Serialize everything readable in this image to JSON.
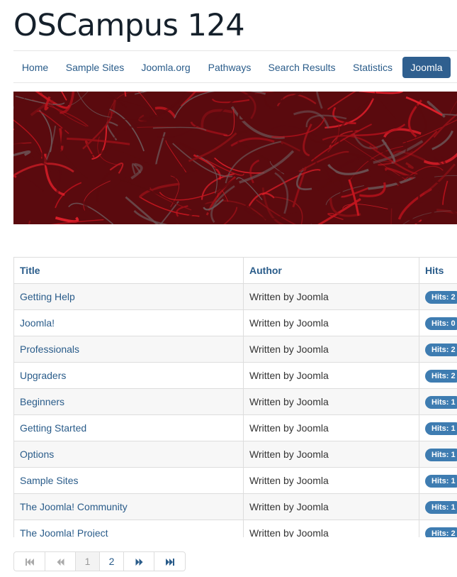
{
  "site": {
    "title": "OSCampus 124"
  },
  "nav": {
    "items": [
      {
        "label": "Home"
      },
      {
        "label": "Sample Sites"
      },
      {
        "label": "Joomla.org"
      },
      {
        "label": "Pathways"
      },
      {
        "label": "Search Results"
      },
      {
        "label": "Statistics"
      },
      {
        "label": "Joomla",
        "active": true
      }
    ]
  },
  "hero": {
    "image": "red-grass-banner",
    "colors": {
      "dark": "#5a0a0e",
      "mid": "#b3111b",
      "bright": "#e01f2a"
    }
  },
  "table": {
    "headers": {
      "title": "Title",
      "author": "Author",
      "hits": "Hits"
    },
    "rows": [
      {
        "title": "Getting Help",
        "author": "Written by Joomla",
        "hits": "Hits: 2"
      },
      {
        "title": "Joomla!",
        "author": "Written by Joomla",
        "hits": "Hits: 0"
      },
      {
        "title": "Professionals",
        "author": "Written by Joomla",
        "hits": "Hits: 2"
      },
      {
        "title": "Upgraders",
        "author": "Written by Joomla",
        "hits": "Hits: 2"
      },
      {
        "title": "Beginners",
        "author": "Written by Joomla",
        "hits": "Hits: 1"
      },
      {
        "title": "Getting Started",
        "author": "Written by Joomla",
        "hits": "Hits: 1"
      },
      {
        "title": "Options",
        "author": "Written by Joomla",
        "hits": "Hits: 1"
      },
      {
        "title": "Sample Sites",
        "author": "Written by Joomla",
        "hits": "Hits: 1"
      },
      {
        "title": "The Joomla! Community",
        "author": "Written by Joomla",
        "hits": "Hits: 1"
      },
      {
        "title": "The Joomla! Project",
        "author": "Written by Joomla",
        "hits": "Hits: 2"
      }
    ]
  },
  "pagination": {
    "first_icon": "first-page-icon",
    "prev_icon": "previous-page-icon",
    "pages": [
      "1",
      "2"
    ],
    "current": "1",
    "next_icon": "next-page-icon",
    "last_icon": "last-page-icon"
  },
  "colors": {
    "link": "#2a5c8a",
    "active_nav": "#2f5f8f",
    "badge": "#3e7cb1"
  }
}
